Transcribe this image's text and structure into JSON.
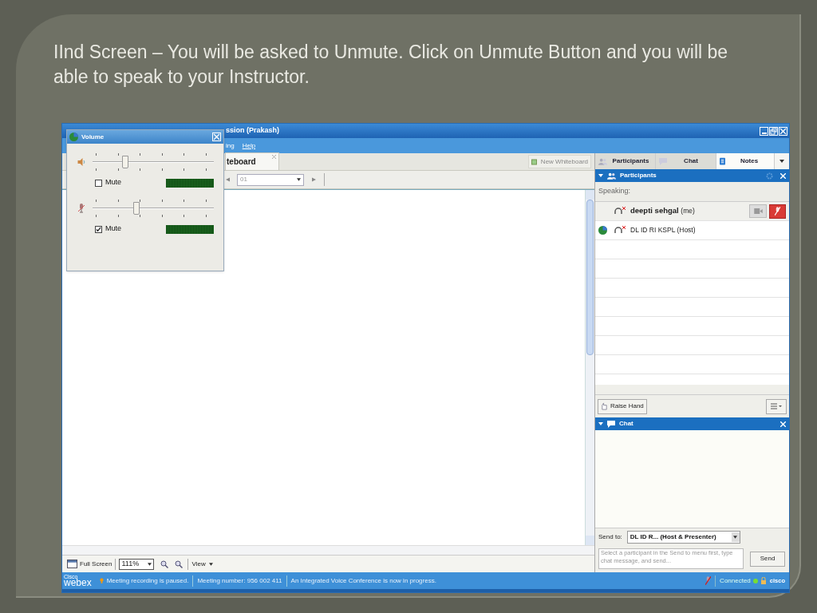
{
  "slide": {
    "heading": "IInd Screen – You will be asked to Unmute. Click on Unmute Button and you will be able to speak to your Instructor."
  },
  "window": {
    "title": "ssion (Prakash)",
    "menu": [
      "ing",
      "Help"
    ]
  },
  "whiteboard": {
    "tab": "teboard",
    "new_button": "New Whiteboard",
    "page_field": "01"
  },
  "zoom_bar": {
    "full_screen": "Full Screen",
    "zoom": "111%",
    "view": "View"
  },
  "panel_tabs": [
    {
      "label": "Participants",
      "open": true
    },
    {
      "label": "Chat",
      "open": true
    },
    {
      "label": "Notes",
      "open": false
    }
  ],
  "participants": {
    "title": "Participants",
    "speaking_label": "Speaking:",
    "rows": [
      {
        "kind": "self",
        "name": "deepti sehgal",
        "role": "(me)"
      },
      {
        "kind": "host",
        "name": "DL ID RI KSPL",
        "role": "(Host)"
      }
    ],
    "raise_hand": "Raise Hand"
  },
  "chat": {
    "title": "Chat",
    "send_to_label": "Send to:",
    "send_to": "DL ID R... (Host & Presenter)",
    "placeholder": "Select a participant in the Send to menu first, type chat message, and send...",
    "send_button": "Send"
  },
  "status_bar": {
    "brand_small": "Cisco",
    "brand": "webex",
    "messages": [
      "Meeting recording is paused.",
      "Meeting number: 956 002 411",
      "An Integrated Voice Conference is now in progress."
    ],
    "connection": "Connected",
    "cisco_logo": "cisco"
  },
  "volume_dialog": {
    "title": "Volume",
    "channels": [
      {
        "kind": "speaker",
        "level": 0.27,
        "muted": false,
        "mute_label": "Mute"
      },
      {
        "kind": "microphone",
        "level": 0.36,
        "muted": true,
        "mute_label": "Mute"
      }
    ]
  }
}
